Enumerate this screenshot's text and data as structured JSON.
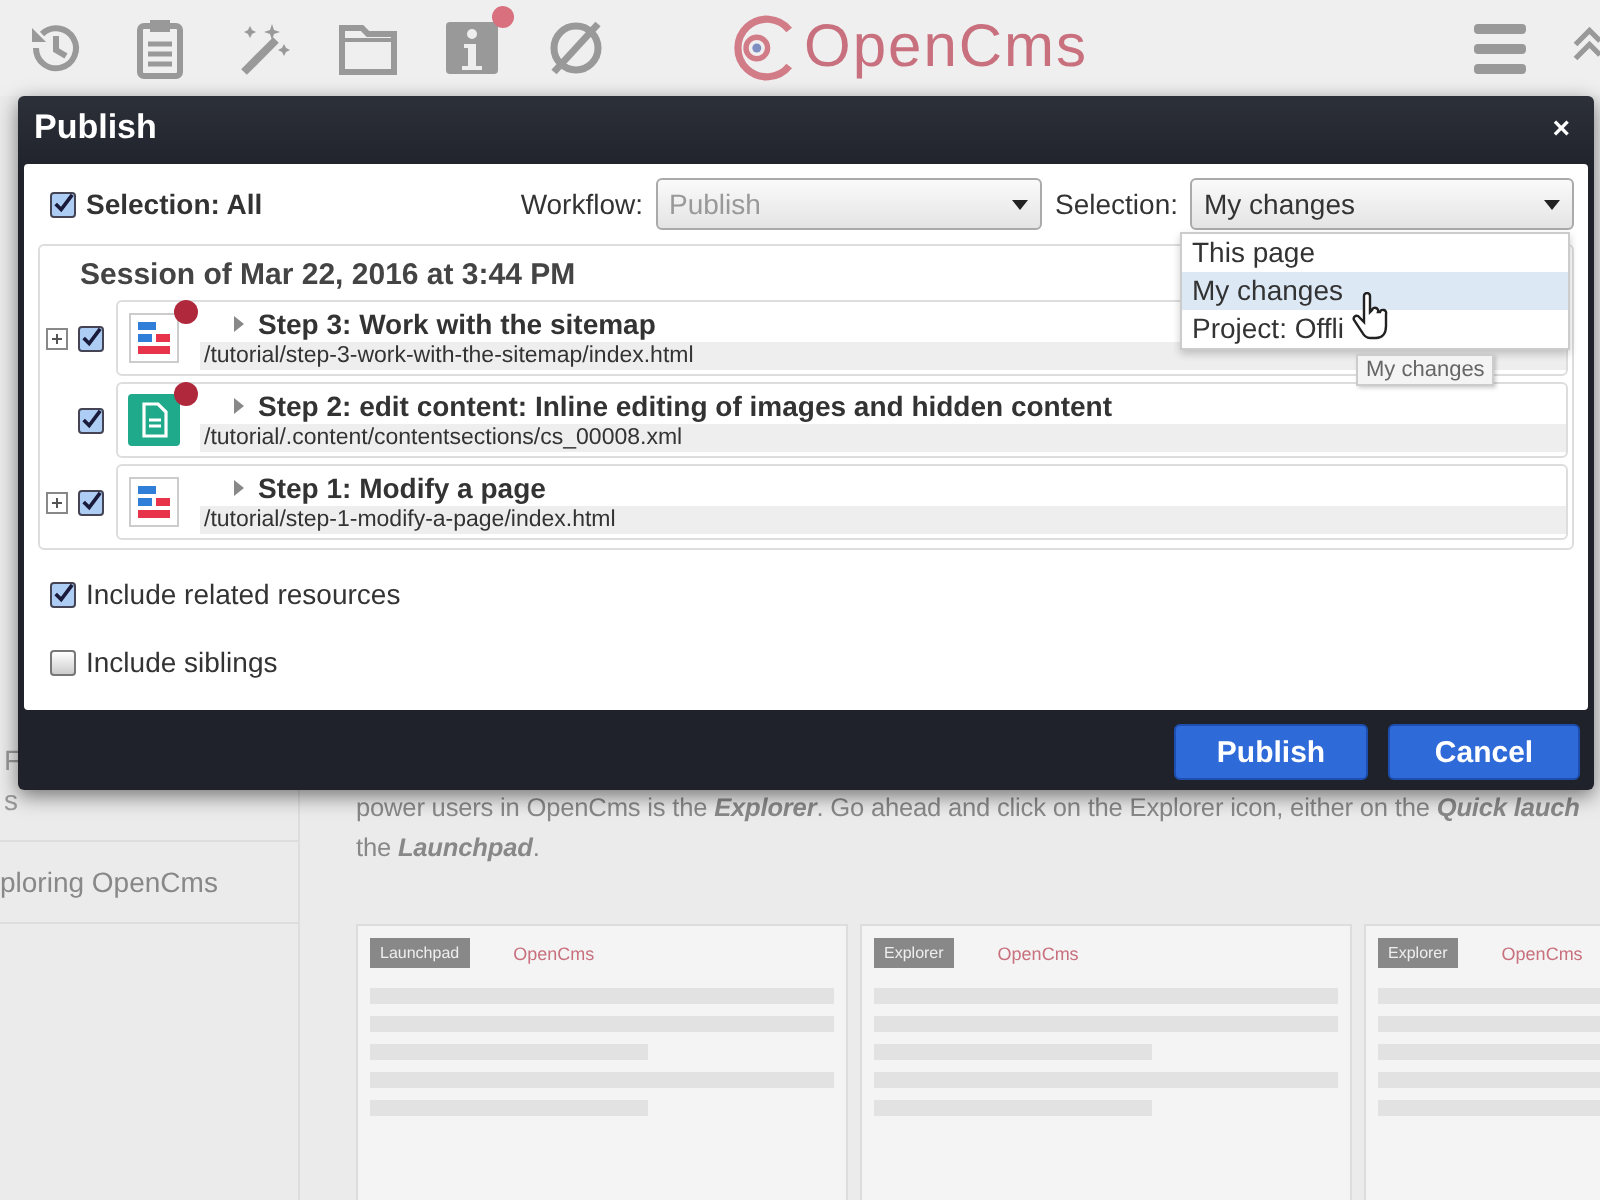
{
  "toolbar": {
    "logo": "OpenCms",
    "info_notification": true
  },
  "background": {
    "sidebar": [
      {
        "label": "F"
      },
      {
        "label": "s"
      },
      {
        "label": "ploring OpenCms"
      }
    ],
    "paragraph": [
      "power users in OpenCms is the **Explorer**. Go ahead and click on the Explorer icon, either on the **Quick lauch**",
      "the **Launchpad**."
    ],
    "thumbnails": [
      {
        "label": "Launchpad",
        "logo": "OpenCms"
      },
      {
        "label": "Explorer",
        "logo": "OpenCms"
      },
      {
        "label": "Explorer",
        "logo": "OpenCms"
      }
    ]
  },
  "dialog": {
    "title": "Publish",
    "close": "×",
    "selection_all": {
      "label": "Selection: All",
      "checked": true
    },
    "workflow": {
      "label": "Workflow:",
      "value": "Publish"
    },
    "selection": {
      "label": "Selection:",
      "value": "My changes",
      "options": [
        {
          "label": "This page",
          "selected": false
        },
        {
          "label": "My changes",
          "selected": true
        },
        {
          "label": "Project: Offli",
          "selected": false
        }
      ],
      "tooltip": "My changes"
    },
    "session": {
      "title": "Session of Mar 22, 2016 at 3:44 PM",
      "items": [
        {
          "kind": "page",
          "title": "Step 3: Work with the sitemap",
          "path": "/tutorial/step-3-work-with-the-sitemap/index.html",
          "expandable": true,
          "checked": true,
          "changed": true
        },
        {
          "kind": "content",
          "title": "Step 2: edit content: Inline editing of images and hidden content",
          "path": "/tutorial/.content/contentsections/cs_00008.xml",
          "expandable": false,
          "checked": true,
          "changed": true
        },
        {
          "kind": "page",
          "title": "Step 1: Modify a page",
          "path": "/tutorial/step-1-modify-a-page/index.html",
          "expandable": true,
          "checked": true,
          "changed": false
        }
      ]
    },
    "options": [
      {
        "label": "Include related resources",
        "checked": true
      },
      {
        "label": "Include siblings",
        "checked": false
      }
    ],
    "buttons": [
      {
        "label": "Publish"
      },
      {
        "label": "Cancel"
      }
    ]
  }
}
